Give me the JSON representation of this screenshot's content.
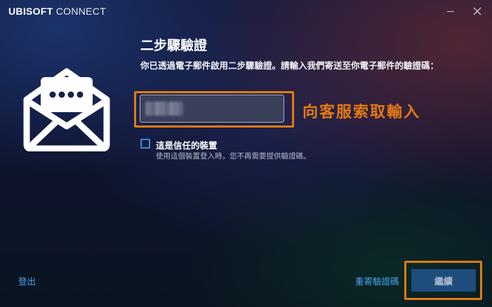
{
  "window": {
    "brand_bold": "UBISOFT",
    "brand_light": " CONNECT",
    "minimize_icon": "minimize-icon",
    "close_icon": "close-icon",
    "close_glyph": "✕"
  },
  "main": {
    "icon": "envelope-open-icon",
    "title": "二步驟驗證",
    "description": "你已透過電子郵件啟用二步驟驗證。請輸入我們寄送至你電子郵件的驗證碼：",
    "code_input": {
      "value": "",
      "placeholder": ""
    },
    "annotation": "向客服索取輸入",
    "trusted_device": {
      "checked": false,
      "label": "這是信任的裝置",
      "sublabel": "使用這個裝置登入時，您不再需要提供驗證碼。"
    }
  },
  "footer": {
    "logout_label": "登出",
    "resend_label": "重寄驗證碼",
    "continue_label": "繼續"
  },
  "colors": {
    "accent_link": "#4aa3f0",
    "annotation": "#e37a12",
    "button_bg": "#1e4d7d"
  }
}
